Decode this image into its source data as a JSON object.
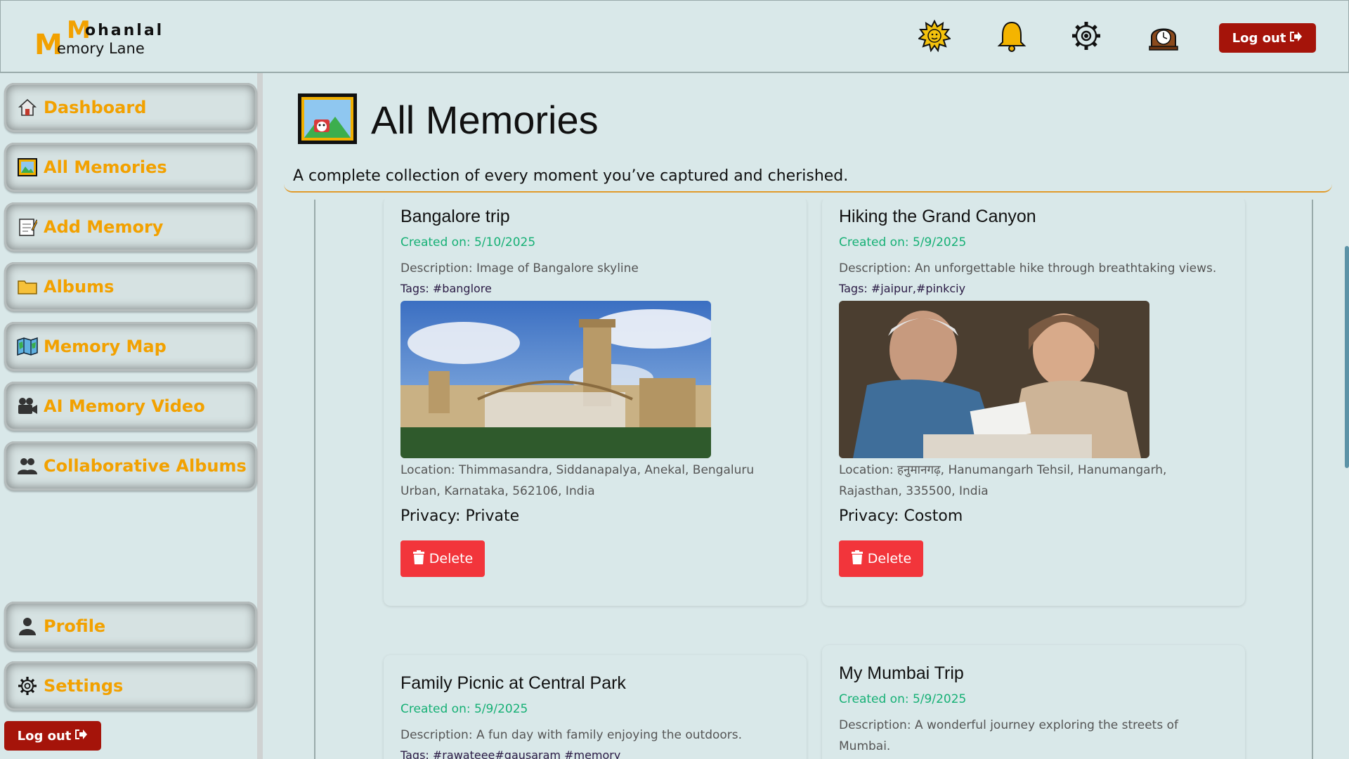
{
  "app": {
    "logo_big_m_top": "M",
    "logo_word_top": "ohanlal",
    "logo_big_m_bottom": "M",
    "logo_word_bottom": "emory Lane"
  },
  "header": {
    "icons": [
      "sun-icon",
      "bell-icon",
      "gear-icon",
      "clock-icon"
    ],
    "logout_label": "Log out"
  },
  "sidebar": {
    "items": [
      {
        "label": "Dashboard",
        "icon": "house-icon"
      },
      {
        "label": "All Memories",
        "icon": "picture-icon"
      },
      {
        "label": "Add Memory",
        "icon": "memo-icon"
      },
      {
        "label": "Albums",
        "icon": "folder-icon"
      },
      {
        "label": "Memory Map",
        "icon": "map-icon"
      },
      {
        "label": "AI Memory Video",
        "icon": "video-camera-icon"
      },
      {
        "label": "Collaborative Albums",
        "icon": "people-icon"
      }
    ],
    "bottom_items": [
      {
        "label": "Profile",
        "icon": "person-icon"
      },
      {
        "label": "Settings",
        "icon": "gear-icon"
      }
    ],
    "logout_label": "Log out"
  },
  "main": {
    "title": "All Memories",
    "subtitle": "A complete collection of every moment you’ve captured and cherished.",
    "cards": [
      {
        "title": "Bangalore trip",
        "created": "Created on: 5/10/2025",
        "description": "Description: Image of Bangalore skyline",
        "tags": "Tags: #banglore",
        "location": "Location: Thimmasandra, Siddanapalya, Anekal, Bengaluru Urban, Karnataka, 562106, India",
        "privacy": "Privacy: Private",
        "delete_label": "Delete"
      },
      {
        "title": "Hiking the Grand Canyon",
        "created": "Created on: 5/9/2025",
        "description": "Description: An unforgettable hike through breathtaking views.",
        "tags": "Tags: #jaipur,#pinkciy",
        "location": "Location: हनुमानगढ़, Hanumangarh Tehsil, Hanumangarh, Rajasthan, 335500, India",
        "privacy": "Privacy: Costom",
        "delete_label": "Delete"
      },
      {
        "title": "Family Picnic at Central Park",
        "created": "Created on: 5/9/2025",
        "description": "Description: A fun day with family enjoying the outdoors.",
        "tags": "Tags: #rawateee#gausaram #memory"
      },
      {
        "title": "My Mumbai Trip",
        "created": "Created on: 5/9/2025",
        "description": "Description: A wonderful journey exploring the streets of Mumbai."
      }
    ]
  },
  "colors": {
    "accent": "#f2a100",
    "logout": "#a5140a",
    "delete": "#f2353b",
    "created": "#16b075",
    "background": "#d9e8e9"
  }
}
